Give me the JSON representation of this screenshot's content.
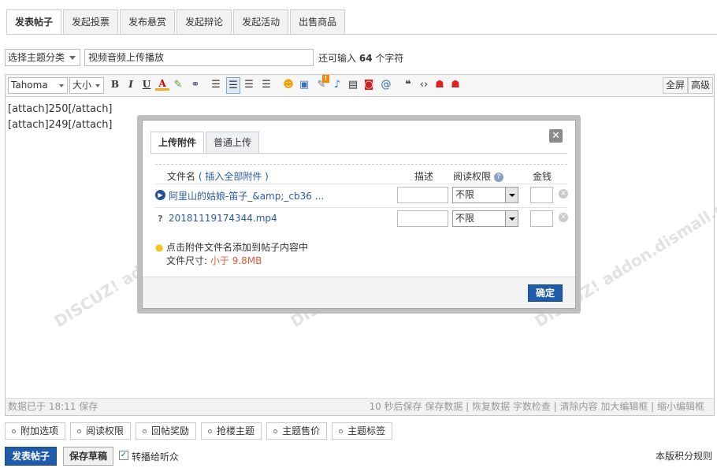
{
  "tabs": [
    "发表帖子",
    "发起投票",
    "发布悬赏",
    "发起辩论",
    "发起活动",
    "出售商品"
  ],
  "subject": {
    "category": "选择主题分类",
    "title": "视频音频上传播放",
    "remain_prefix": "还可输入",
    "remain_count": "64",
    "remain_suffix": "个字符"
  },
  "toolbar": {
    "font": "Tahoma",
    "size": "大小",
    "fullscreen": "全屏",
    "advanced": "高级"
  },
  "editor": {
    "lines": [
      "[attach]250[/attach]",
      "[attach]249[/attach]"
    ]
  },
  "status": {
    "left": "数据已于 18:11 保存",
    "right": "10 秒后保存 保存数据 | 恢复数据    字数检查 | 清除内容    加大编辑框 | 缩小编辑框"
  },
  "watermark": "DISCUZ!应用中心 | 贰道  addon.dismall.com",
  "dialog": {
    "tabs": [
      "上传附件",
      "普通上传"
    ],
    "close": "✕",
    "head_filename": "文件名",
    "head_insert_all": "( 插入全部附件 )",
    "head_desc": "描述",
    "head_perm": "阅读权限",
    "head_money": "金钱",
    "files": [
      {
        "name": "阿里山的姑娘-笛子_&amp;_cb36 ...",
        "icon": "play-icon",
        "perm": "不限"
      },
      {
        "name": "20181119174344.mp4",
        "icon": "unknown-file-icon",
        "perm": "不限"
      }
    ],
    "tip_line1": "点击附件文件名添加到帖子内容中",
    "tip_size_label": "文件尺寸:",
    "tip_size_value": "小于 9.8MB",
    "confirm": "确定"
  },
  "options": [
    "附加选项",
    "阅读权限",
    "回帖奖励",
    "抢楼主题",
    "主题售价",
    "主题标签"
  ],
  "actions": {
    "post": "发表帖子",
    "draft": "保存草稿",
    "forward": "转播给听众",
    "rules": "本版积分规则"
  }
}
